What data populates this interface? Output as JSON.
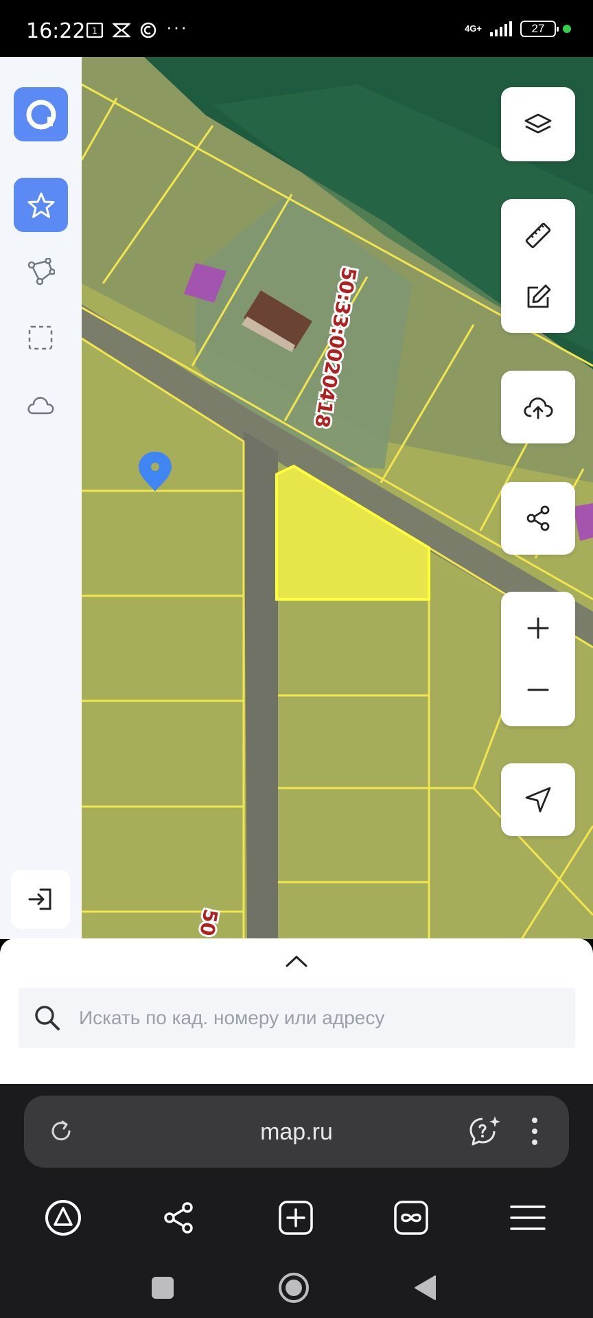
{
  "status_bar": {
    "time": "16:22",
    "network": "4G+",
    "battery": "27",
    "more": "···"
  },
  "map": {
    "cadastral_labels": [
      {
        "text": "50:33:0020418"
      },
      {
        "text": "50"
      }
    ],
    "colors": {
      "selected_parcel": "#e6e64a",
      "parcel_border": "#f2e64e",
      "building_marker": "#a64bb7",
      "location_pin": "#3f86f3",
      "forest": "#1d5a3e",
      "field": "#a7ae59"
    }
  },
  "sidebar": {
    "items": [
      {
        "icon": "app-logo-icon"
      },
      {
        "icon": "star-icon",
        "active": true
      },
      {
        "icon": "polygon-icon"
      },
      {
        "icon": "selection-square-icon"
      },
      {
        "icon": "cloud-icon"
      }
    ],
    "login_icon": "login-icon"
  },
  "controls": {
    "layers": "layers-icon",
    "ruler": "ruler-icon",
    "edit": "edit-icon",
    "upload": "cloud-upload-icon",
    "share": "share-icon",
    "zoom_in": "plus-icon",
    "zoom_out": "minus-icon",
    "locate": "navigation-arrow-icon"
  },
  "search": {
    "placeholder": "Искать по кад. номеру или адресу"
  },
  "browser": {
    "url": "map.ru",
    "colors": {
      "background": "#1b1b1d",
      "urlbar": "#3a3a3e"
    }
  },
  "accent": "#5b8af5"
}
